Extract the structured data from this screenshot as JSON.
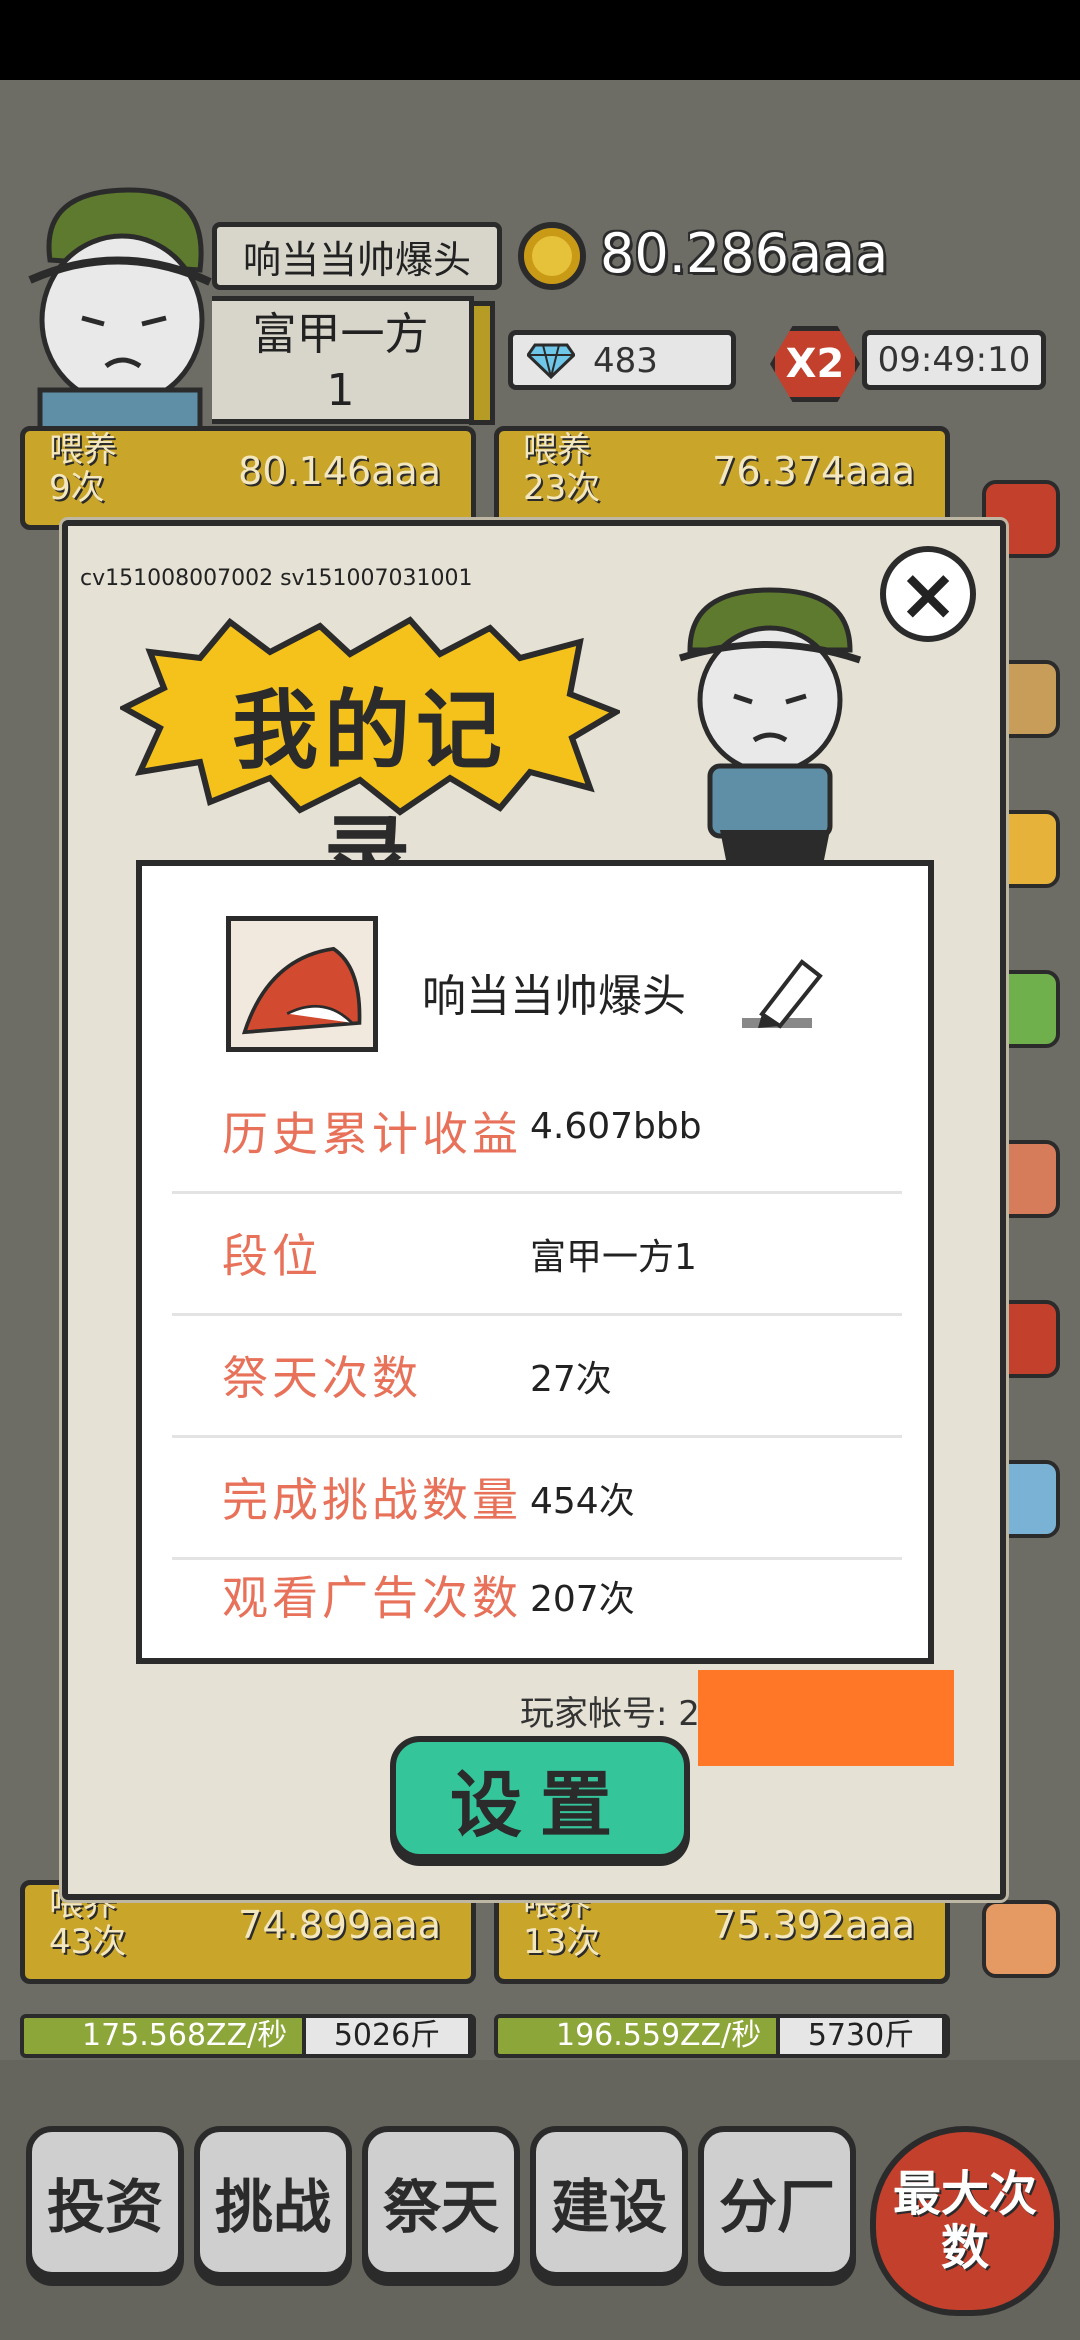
{
  "header": {
    "player_name": "响当当帅爆头",
    "rank_name": "富甲一方",
    "rank_level": "1",
    "coins": "80.286aaa",
    "gems": "483",
    "multiplier": "X2",
    "timer": "09:49:10"
  },
  "cards": [
    {
      "feed_label": "喂养",
      "feed_count": "9次",
      "amount": "80.146aaa"
    },
    {
      "feed_label": "喂养",
      "feed_count": "23次",
      "amount": "76.374aaa"
    },
    {
      "feed_label": "喂养",
      "feed_count": "43次",
      "amount": "74.899aaa"
    },
    {
      "feed_label": "喂养",
      "feed_count": "13次",
      "amount": "75.392aaa"
    }
  ],
  "strips": [
    {
      "rate": "175.568ZZ/秒",
      "weight": "5026斤"
    },
    {
      "rate": "196.559ZZ/秒",
      "weight": "5730斤"
    }
  ],
  "modal": {
    "version": "cv151008007002 sv151007031001",
    "title": "我的记录",
    "close_icon": "×",
    "profile_name": "响当当帅爆头",
    "rows": [
      {
        "label": "历史累计收益",
        "value": "4.607bbb"
      },
      {
        "label": "段位",
        "value": "富甲一方1"
      },
      {
        "label": "祭天次数",
        "value": "27次"
      },
      {
        "label": "完成挑战数量",
        "value": "454次"
      },
      {
        "label": "观看广告次数",
        "value": "207次"
      }
    ],
    "account_label": "玩家帐号: 2",
    "settings_label": "设置"
  },
  "nav": {
    "items": [
      "投资",
      "挑战",
      "祭天",
      "建设",
      "分厂"
    ],
    "max_label": "最大次数"
  },
  "colors": {
    "modal_bg": "#e5e1d4",
    "label_red": "#e8715a",
    "settings_green": "#35c59b",
    "title_yellow": "#f4c21b",
    "card_gold": "#c9a52a",
    "redact_orange": "#ff7727"
  }
}
